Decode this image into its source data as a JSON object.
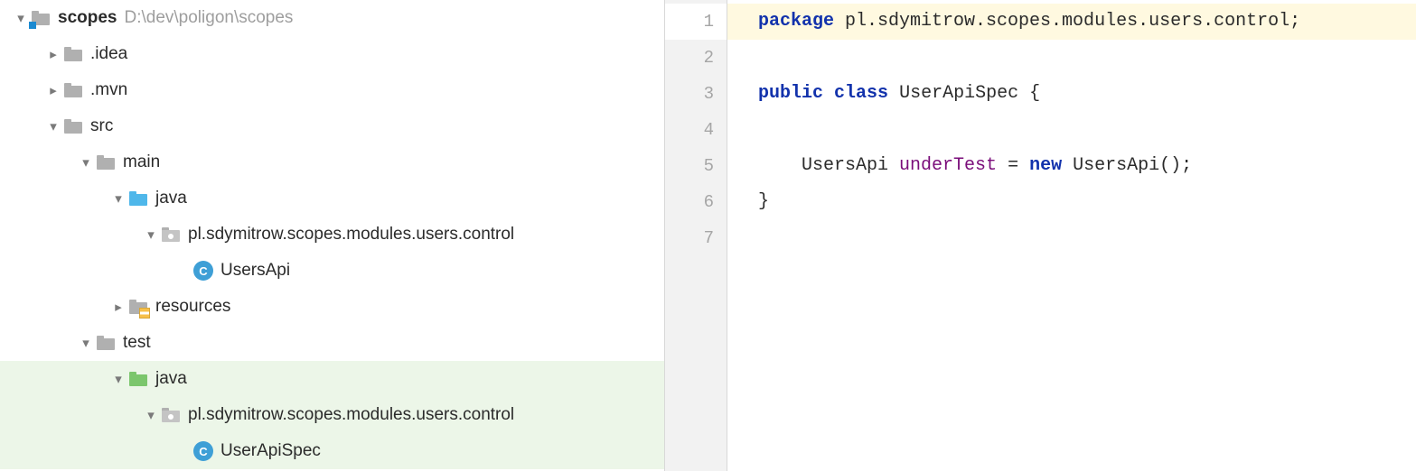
{
  "tree": {
    "root": {
      "label": "scopes",
      "path": "D:\\dev\\poligon\\scopes"
    },
    "idea": {
      "label": ".idea"
    },
    "mvn": {
      "label": ".mvn"
    },
    "src": {
      "label": "src"
    },
    "main": {
      "label": "main"
    },
    "java_main": {
      "label": "java"
    },
    "pkg_main": {
      "label": "pl.sdymitrow.scopes.modules.users.control"
    },
    "cls_main": {
      "label": "UsersApi"
    },
    "resources": {
      "label": "resources"
    },
    "test": {
      "label": "test"
    },
    "java_test": {
      "label": "java"
    },
    "pkg_test": {
      "label": "pl.sdymitrow.scopes.modules.users.control"
    },
    "cls_test": {
      "label": "UserApiSpec"
    }
  },
  "gutter": [
    "1",
    "2",
    "3",
    "4",
    "5",
    "6",
    "7"
  ],
  "code": {
    "kw_package": "package",
    "pkg_stmt": " pl.sdymitrow.scopes.modules.users.control;",
    "kw_public": "public",
    "kw_class": "class",
    "cls_name": "UserApiSpec",
    "brace_o": " {",
    "type": "UsersApi",
    "field": "underTest",
    "eq": " = ",
    "kw_new": "new",
    "ctor": " UsersApi();",
    "brace_c": "}",
    "indent1": "    ",
    "sp": " "
  }
}
